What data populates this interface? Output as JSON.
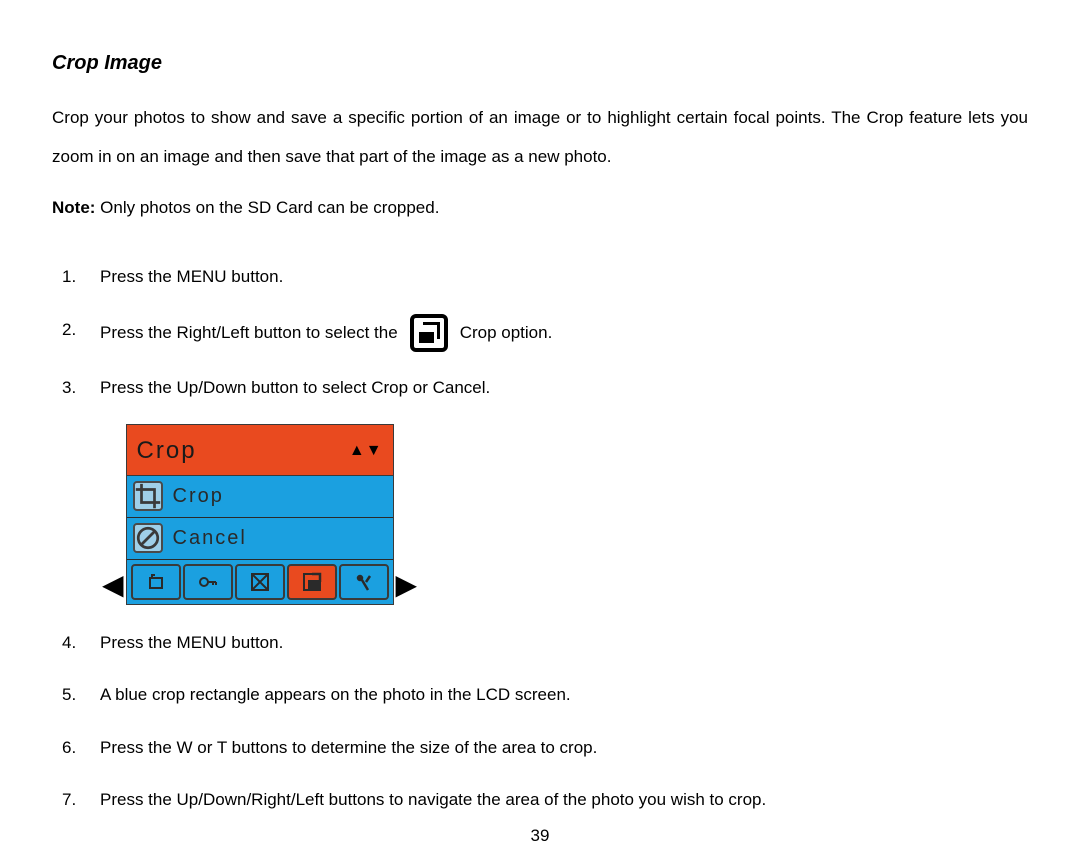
{
  "title": "Crop Image",
  "intro": "Crop your photos to show and save a specific portion of an image or to highlight certain focal points. The Crop feature lets you zoom in on an image and then save that part of the image as a new photo.",
  "note_label": "Note:",
  "note_text": " Only photos on the SD Card can be cropped.",
  "steps": {
    "s1": "Press the MENU button.",
    "s2a": "Press the Right/Left button to select the",
    "s2b": "Crop option.",
    "s3": "Press the Up/Down button to select Crop or Cancel.",
    "s4": "Press the MENU button.",
    "s5": "A blue crop rectangle appears on the photo in the LCD screen.",
    "s6": "Press the W or T buttons to determine the size of the area to crop.",
    "s7": "Press the Up/Down/Right/Left buttons to navigate the area of the photo you wish to crop."
  },
  "menu": {
    "header": "Crop",
    "header_arrows": "▲▼",
    "row1_label": "Crop",
    "row2_label": "Cancel",
    "left_arrow": "◀",
    "right_arrow": "▶"
  },
  "page_number": "39"
}
